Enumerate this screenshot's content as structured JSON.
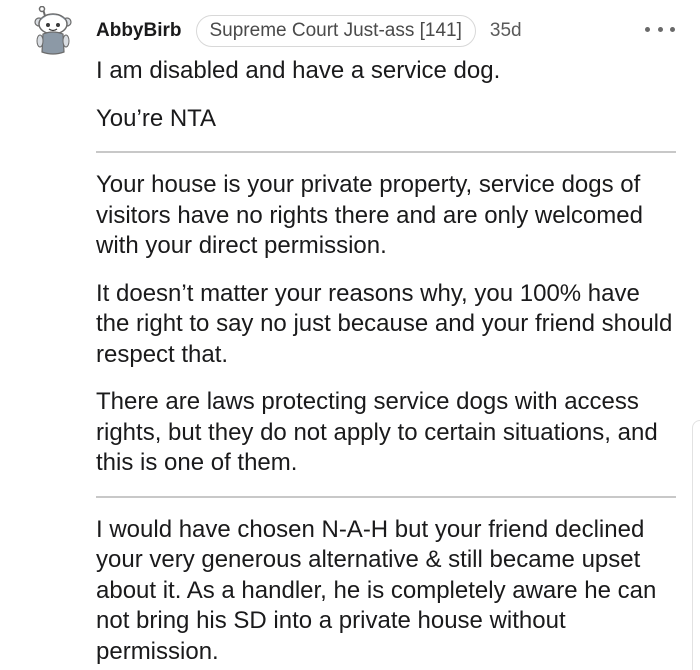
{
  "comment": {
    "username": "AbbyBirb",
    "flair": "Supreme Court Just-ass [141]",
    "age": "35d",
    "avatar": "snoo-avatar-icon",
    "more_icon": "more-options-icon",
    "paragraphs": {
      "p1": "I am disabled and have a service dog.",
      "p2": "You’re NTA",
      "p3": "Your house is your private property, service dogs of visitors have no rights there and are only welcomed with your direct permission.",
      "p4": "It doesn’t matter your reasons why, you 100% have the right to say no just because and your friend should respect that.",
      "p5": "There are laws protecting service dogs with access rights, but they do not apply to certain situations, and this is one of them.",
      "p6": "I would have chosen N-A-H but your friend declined your very generous alternative & still became upset about it. As a handler, he is completely aware he can not bring his SD into a private house without permission."
    }
  }
}
